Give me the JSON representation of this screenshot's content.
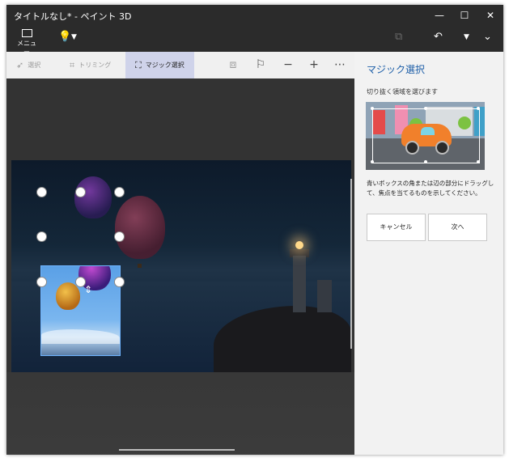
{
  "window": {
    "title": "タイトルなし* - ペイント 3D",
    "controls": {
      "minimize": "—",
      "maximize": "☐",
      "close": "✕"
    }
  },
  "toolbar": {
    "menu_label": "メニュー",
    "icons": [
      "folder-icon",
      "idea-bulb-icon",
      "chevron-down-icon",
      "paste-icon",
      "undo-icon",
      "more-chevron-icon",
      "expand-chevron-icon"
    ]
  },
  "commandbar": {
    "select_label": "選択",
    "crop_label": "トリミング",
    "magic_select_label": "マジック選択",
    "icons": [
      "3d-view-icon",
      "flag-icon",
      "zoom-out-icon",
      "zoom-in-icon",
      "more-icon"
    ]
  },
  "panel": {
    "title": "マジック選択",
    "instruction": "切り抜く領域を選びます",
    "description": "青いボックスの角または辺の部分にドラッグして、焦点を当てるものを示してください。",
    "cancel_label": "キャンセル",
    "next_label": "次へ"
  },
  "colors": {
    "title_bar": "#2b2b2b",
    "accent": "#1e5fa8",
    "active_tool_bg": "#cfd3ea",
    "selection_border": "#6fb4ff"
  }
}
